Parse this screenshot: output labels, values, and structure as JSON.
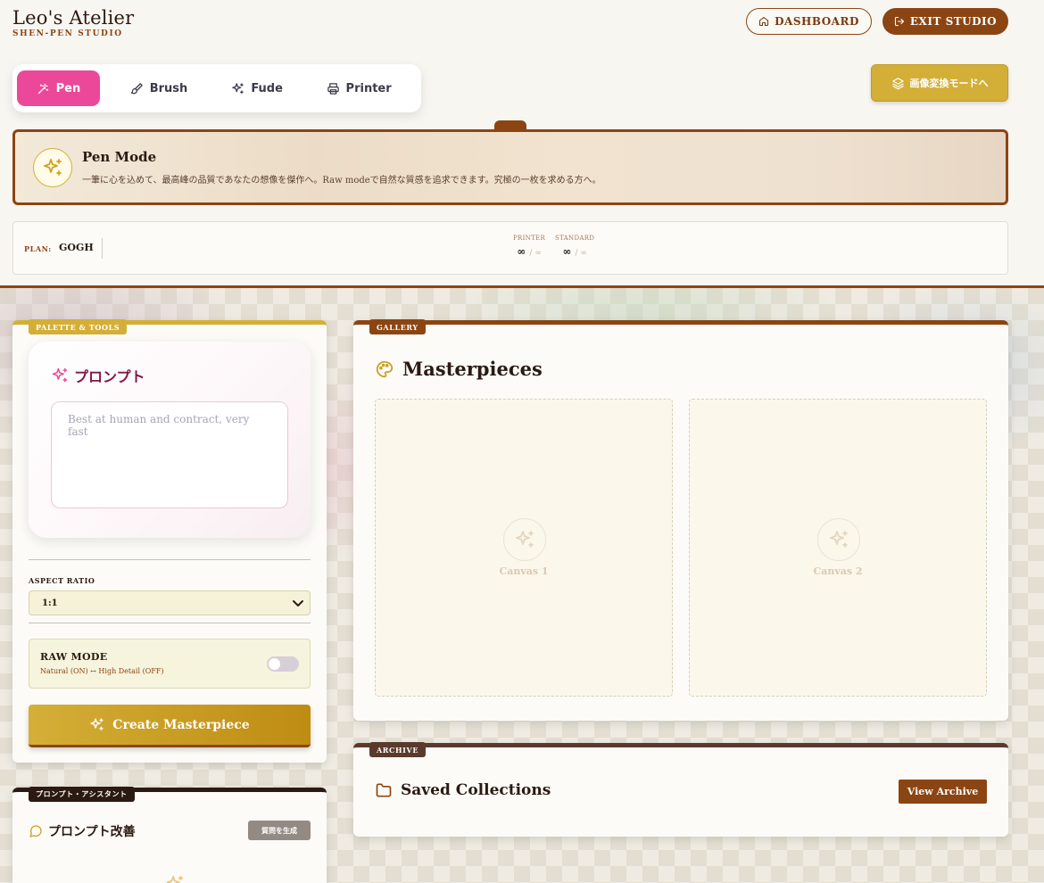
{
  "header": {
    "brand_title": "Leo's Atelier",
    "brand_subtitle": "SHEN-PEN STUDIO",
    "dashboard_label": "DASHBOARD",
    "exit_label": "EXIT STUDIO"
  },
  "mode_tabs": {
    "active": "Pen",
    "items": [
      {
        "label": "Pen",
        "icon": "pen-icon"
      },
      {
        "label": "Brush",
        "icon": "brush-icon"
      },
      {
        "label": "Fude",
        "icon": "sparkles-icon"
      },
      {
        "label": "Printer",
        "icon": "printer-icon"
      }
    ]
  },
  "convert_button": {
    "label": "画像変換モードへ",
    "icon": "layers-icon"
  },
  "mode_banner": {
    "title": "Pen Mode",
    "description": "一筆に心を込めて、最高峰の品質であなたの想像を傑作へ。Raw modeで自然な質感を追求できます。究極の一枚を求める方へ。",
    "icon": "sparkles-icon"
  },
  "plan": {
    "label": "PLAN:",
    "value": "GOGH",
    "quotas": [
      {
        "label": "PRINTER",
        "value": "∞",
        "max": "∞"
      },
      {
        "label": "STANDARD",
        "value": "∞",
        "max": "∞"
      }
    ]
  },
  "palette": {
    "tag": "PALETTE & TOOLS",
    "prompt_title": "プロンプト",
    "prompt_placeholder": "Best at human and contract, very fast",
    "prompt_value": "",
    "aspect_label": "ASPECT RATIO",
    "aspect_value": "1:1",
    "raw_title": "RAW MODE",
    "raw_subtitle": "Natural (ON) ↔ High Detail (OFF)",
    "raw_enabled": false,
    "create_label": "Create Masterpiece"
  },
  "assistant": {
    "tag": "プロンプト・アシスタント",
    "title": "プロンプト改善",
    "generate_label": "質問を生成"
  },
  "gallery": {
    "tag": "GALLERY",
    "title": "Masterpieces",
    "canvases": [
      {
        "label": "Canvas 1"
      },
      {
        "label": "Canvas 2"
      }
    ]
  },
  "archive": {
    "tag": "ARCHIVE",
    "title": "Saved Collections",
    "view_label": "View Archive"
  },
  "colors": {
    "brown": "#8b4513",
    "gold": "#d4af37",
    "pink": "#ec4899",
    "dark": "#2a1a12"
  }
}
